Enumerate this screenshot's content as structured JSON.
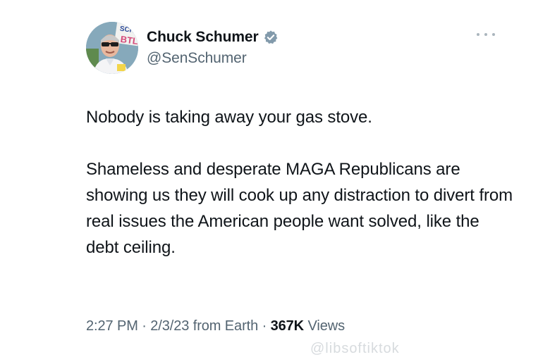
{
  "author": {
    "display_name": "Chuck Schumer",
    "handle": "@SenSchumer",
    "verified_icon": "verified-badge-icon",
    "avatar_sign_text": "SCHU BTL"
  },
  "menu": {
    "more_icon": "more-horizontal-icon"
  },
  "tweet": {
    "paragraph_1": "Nobody is taking away your gas stove.",
    "paragraph_2": "Shameless and desperate MAGA Republicans are showing us they will cook up any distraction to divert from real issues the American people want solved, like the debt ceiling."
  },
  "meta": {
    "time": "2:27 PM",
    "sep_1": " · ",
    "date": "2/3/23",
    "source": " from Earth",
    "sep_2": " · ",
    "views_count": "367K",
    "views_label": " Views"
  },
  "watermark": {
    "text": "@libsoftiktok"
  },
  "colors": {
    "text_primary": "#0f1419",
    "text_secondary": "#536471",
    "verified_badge": "#829aab"
  }
}
